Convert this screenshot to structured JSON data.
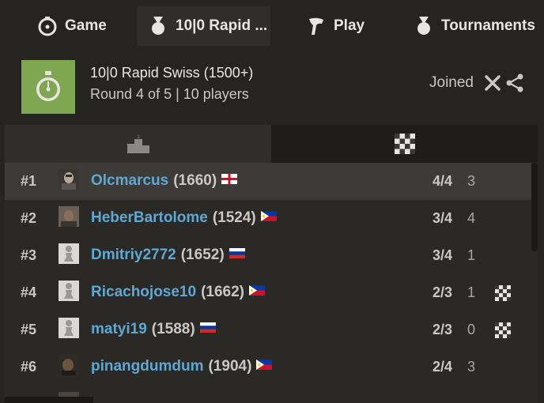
{
  "tabs": [
    {
      "label": "Game",
      "icon": "stopwatch-icon"
    },
    {
      "label": "10|0 Rapid ...",
      "icon": "medal-icon"
    },
    {
      "label": "Play",
      "icon": "pawn-icon"
    },
    {
      "label": "Tournaments",
      "icon": "medal-icon"
    }
  ],
  "tournament": {
    "title": "10|0 Rapid Swiss (1500+)",
    "subtitle": "Round 4 of 5 | 10 players",
    "status": "Joined"
  },
  "players": [
    {
      "rank": "#1",
      "name": "Olcmarcus",
      "rating": "(1660)",
      "flag": "england",
      "score": "4/4",
      "points": "3",
      "board": false,
      "avatar": "photo"
    },
    {
      "rank": "#2",
      "name": "HeberBartolome",
      "rating": "(1524)",
      "flag": "philippines",
      "score": "3/4",
      "points": "4",
      "board": false,
      "avatar": "photo"
    },
    {
      "rank": "#3",
      "name": "Dmitriy2772",
      "rating": "(1652)",
      "flag": "russia",
      "score": "3/4",
      "points": "1",
      "board": false,
      "avatar": "pawn"
    },
    {
      "rank": "#4",
      "name": "Ricachojose10",
      "rating": "(1662)",
      "flag": "philippines",
      "score": "2/3",
      "points": "1",
      "board": true,
      "avatar": "pawn"
    },
    {
      "rank": "#5",
      "name": "matyi19",
      "rating": "(1588)",
      "flag": "russia",
      "score": "2/3",
      "points": "0",
      "board": true,
      "avatar": "pawn"
    },
    {
      "rank": "#6",
      "name": "pinangdumdum",
      "rating": "(1904)",
      "flag": "philippines",
      "score": "2/4",
      "points": "3",
      "board": false,
      "avatar": "photo"
    }
  ],
  "colors": {
    "accent_link": "#5fa8d3",
    "thumb_green": "#7fa650"
  }
}
